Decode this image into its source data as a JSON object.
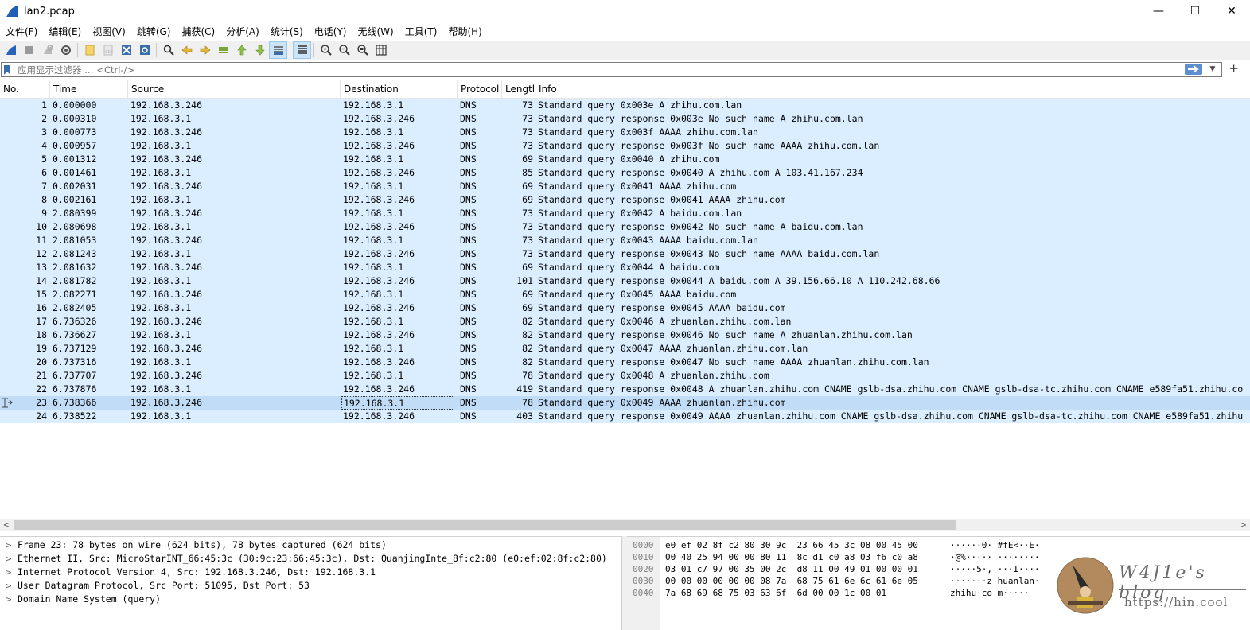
{
  "window": {
    "title": "lan2.pcap",
    "minimize": "—",
    "maximize": "☐",
    "close": "✕"
  },
  "menu": [
    "文件(F)",
    "编辑(E)",
    "视图(V)",
    "跳转(G)",
    "捕获(C)",
    "分析(A)",
    "统计(S)",
    "电话(Y)",
    "无线(W)",
    "工具(T)",
    "帮助(H)"
  ],
  "toolbar_icons": [
    "shark-fin-start-icon",
    "stop-icon",
    "restart-icon",
    "capture-options-icon",
    "open-file-icon",
    "save-file-icon",
    "close-file-icon",
    "reload-icon",
    "find-packet-icon",
    "go-back-icon",
    "go-forward-icon",
    "go-to-packet-icon",
    "go-first-icon",
    "go-last-icon",
    "autoscroll-icon",
    "colorize-icon",
    "zoom-in-icon",
    "zoom-out-icon",
    "zoom-normal-icon",
    "resize-columns-icon"
  ],
  "filter": {
    "placeholder": "应用显示过滤器 … <Ctrl-/>",
    "add": "+"
  },
  "columns": {
    "no": "No.",
    "time": "Time",
    "source": "Source",
    "destination": "Destination",
    "protocol": "Protocol",
    "length": "Lengtl",
    "info": "Info"
  },
  "packets": [
    {
      "no": "1",
      "time": "0.000000",
      "src": "192.168.3.246",
      "dst": "192.168.3.1",
      "proto": "DNS",
      "len": "73",
      "info": "Standard query 0x003e A zhihu.com.lan"
    },
    {
      "no": "2",
      "time": "0.000310",
      "src": "192.168.3.1",
      "dst": "192.168.3.246",
      "proto": "DNS",
      "len": "73",
      "info": "Standard query response 0x003e No such name A zhihu.com.lan"
    },
    {
      "no": "3",
      "time": "0.000773",
      "src": "192.168.3.246",
      "dst": "192.168.3.1",
      "proto": "DNS",
      "len": "73",
      "info": "Standard query 0x003f AAAA zhihu.com.lan"
    },
    {
      "no": "4",
      "time": "0.000957",
      "src": "192.168.3.1",
      "dst": "192.168.3.246",
      "proto": "DNS",
      "len": "73",
      "info": "Standard query response 0x003f No such name AAAA zhihu.com.lan"
    },
    {
      "no": "5",
      "time": "0.001312",
      "src": "192.168.3.246",
      "dst": "192.168.3.1",
      "proto": "DNS",
      "len": "69",
      "info": "Standard query 0x0040 A zhihu.com"
    },
    {
      "no": "6",
      "time": "0.001461",
      "src": "192.168.3.1",
      "dst": "192.168.3.246",
      "proto": "DNS",
      "len": "85",
      "info": "Standard query response 0x0040 A zhihu.com A 103.41.167.234"
    },
    {
      "no": "7",
      "time": "0.002031",
      "src": "192.168.3.246",
      "dst": "192.168.3.1",
      "proto": "DNS",
      "len": "69",
      "info": "Standard query 0x0041 AAAA zhihu.com"
    },
    {
      "no": "8",
      "time": "0.002161",
      "src": "192.168.3.1",
      "dst": "192.168.3.246",
      "proto": "DNS",
      "len": "69",
      "info": "Standard query response 0x0041 AAAA zhihu.com"
    },
    {
      "no": "9",
      "time": "2.080399",
      "src": "192.168.3.246",
      "dst": "192.168.3.1",
      "proto": "DNS",
      "len": "73",
      "info": "Standard query 0x0042 A baidu.com.lan"
    },
    {
      "no": "10",
      "time": "2.080698",
      "src": "192.168.3.1",
      "dst": "192.168.3.246",
      "proto": "DNS",
      "len": "73",
      "info": "Standard query response 0x0042 No such name A baidu.com.lan"
    },
    {
      "no": "11",
      "time": "2.081053",
      "src": "192.168.3.246",
      "dst": "192.168.3.1",
      "proto": "DNS",
      "len": "73",
      "info": "Standard query 0x0043 AAAA baidu.com.lan"
    },
    {
      "no": "12",
      "time": "2.081243",
      "src": "192.168.3.1",
      "dst": "192.168.3.246",
      "proto": "DNS",
      "len": "73",
      "info": "Standard query response 0x0043 No such name AAAA baidu.com.lan"
    },
    {
      "no": "13",
      "time": "2.081632",
      "src": "192.168.3.246",
      "dst": "192.168.3.1",
      "proto": "DNS",
      "len": "69",
      "info": "Standard query 0x0044 A baidu.com"
    },
    {
      "no": "14",
      "time": "2.081782",
      "src": "192.168.3.1",
      "dst": "192.168.3.246",
      "proto": "DNS",
      "len": "101",
      "info": "Standard query response 0x0044 A baidu.com A 39.156.66.10 A 110.242.68.66"
    },
    {
      "no": "15",
      "time": "2.082271",
      "src": "192.168.3.246",
      "dst": "192.168.3.1",
      "proto": "DNS",
      "len": "69",
      "info": "Standard query 0x0045 AAAA baidu.com"
    },
    {
      "no": "16",
      "time": "2.082405",
      "src": "192.168.3.1",
      "dst": "192.168.3.246",
      "proto": "DNS",
      "len": "69",
      "info": "Standard query response 0x0045 AAAA baidu.com"
    },
    {
      "no": "17",
      "time": "6.736326",
      "src": "192.168.3.246",
      "dst": "192.168.3.1",
      "proto": "DNS",
      "len": "82",
      "info": "Standard query 0x0046 A zhuanlan.zhihu.com.lan"
    },
    {
      "no": "18",
      "time": "6.736627",
      "src": "192.168.3.1",
      "dst": "192.168.3.246",
      "proto": "DNS",
      "len": "82",
      "info": "Standard query response 0x0046 No such name A zhuanlan.zhihu.com.lan"
    },
    {
      "no": "19",
      "time": "6.737129",
      "src": "192.168.3.246",
      "dst": "192.168.3.1",
      "proto": "DNS",
      "len": "82",
      "info": "Standard query 0x0047 AAAA zhuanlan.zhihu.com.lan"
    },
    {
      "no": "20",
      "time": "6.737316",
      "src": "192.168.3.1",
      "dst": "192.168.3.246",
      "proto": "DNS",
      "len": "82",
      "info": "Standard query response 0x0047 No such name AAAA zhuanlan.zhihu.com.lan"
    },
    {
      "no": "21",
      "time": "6.737707",
      "src": "192.168.3.246",
      "dst": "192.168.3.1",
      "proto": "DNS",
      "len": "78",
      "info": "Standard query 0x0048 A zhuanlan.zhihu.com"
    },
    {
      "no": "22",
      "time": "6.737876",
      "src": "192.168.3.1",
      "dst": "192.168.3.246",
      "proto": "DNS",
      "len": "419",
      "info": "Standard query response 0x0048 A zhuanlan.zhihu.com CNAME gslb-dsa.zhihu.com CNAME gslb-dsa-tc.zhihu.com CNAME e589fa51.zhihu.co"
    },
    {
      "no": "23",
      "time": "6.738366",
      "src": "192.168.3.246",
      "dst": "192.168.3.1",
      "proto": "DNS",
      "len": "78",
      "info": "Standard query 0x0049 AAAA zhuanlan.zhihu.com",
      "selected": true
    },
    {
      "no": "24",
      "time": "6.738522",
      "src": "192.168.3.1",
      "dst": "192.168.3.246",
      "proto": "DNS",
      "len": "403",
      "info": "Standard query response 0x0049 AAAA zhuanlan.zhihu.com CNAME gslb-dsa.zhihu.com CNAME gslb-dsa-tc.zhihu.com CNAME e589fa51.zhihu"
    }
  ],
  "scroll": {
    "left": "<",
    "right": ">"
  },
  "details": [
    {
      "expander": ">",
      "text": "Frame 23: 78 bytes on wire (624 bits), 78 bytes captured (624 bits)"
    },
    {
      "expander": ">",
      "text": "Ethernet II, Src: MicroStarINT_66:45:3c (30:9c:23:66:45:3c), Dst: QuanjingInte_8f:c2:80 (e0:ef:02:8f:c2:80)"
    },
    {
      "expander": ">",
      "text": "Internet Protocol Version 4, Src: 192.168.3.246, Dst: 192.168.3.1"
    },
    {
      "expander": ">",
      "text": "User Datagram Protocol, Src Port: 51095, Dst Port: 53"
    },
    {
      "expander": ">",
      "text": "Domain Name System (query)"
    }
  ],
  "bytes": [
    {
      "offset": "0000",
      "hex": "e0 ef 02 8f c2 80 30 9c  23 66 45 3c 08 00 45 00",
      "ascii": "······0· #fE<··E·"
    },
    {
      "offset": "0010",
      "hex": "00 40 25 94 00 00 80 11  8c d1 c0 a8 03 f6 c0 a8",
      "ascii": "·@%····· ········"
    },
    {
      "offset": "0020",
      "hex": "03 01 c7 97 00 35 00 2c  d8 11 00 49 01 00 00 01",
      "ascii": "·····5·, ···I····"
    },
    {
      "offset": "0030",
      "hex": "00 00 00 00 00 00 08 7a  68 75 61 6e 6c 61 6e 05",
      "ascii": "·······z huanlan·"
    },
    {
      "offset": "0040",
      "hex": "7a 68 69 68 75 03 63 6f  6d 00 00 1c 00 01",
      "ascii": "zhihu·co m·····"
    }
  ],
  "watermark": {
    "title": "W4J1e's blog",
    "url": "https://hin.cool"
  }
}
